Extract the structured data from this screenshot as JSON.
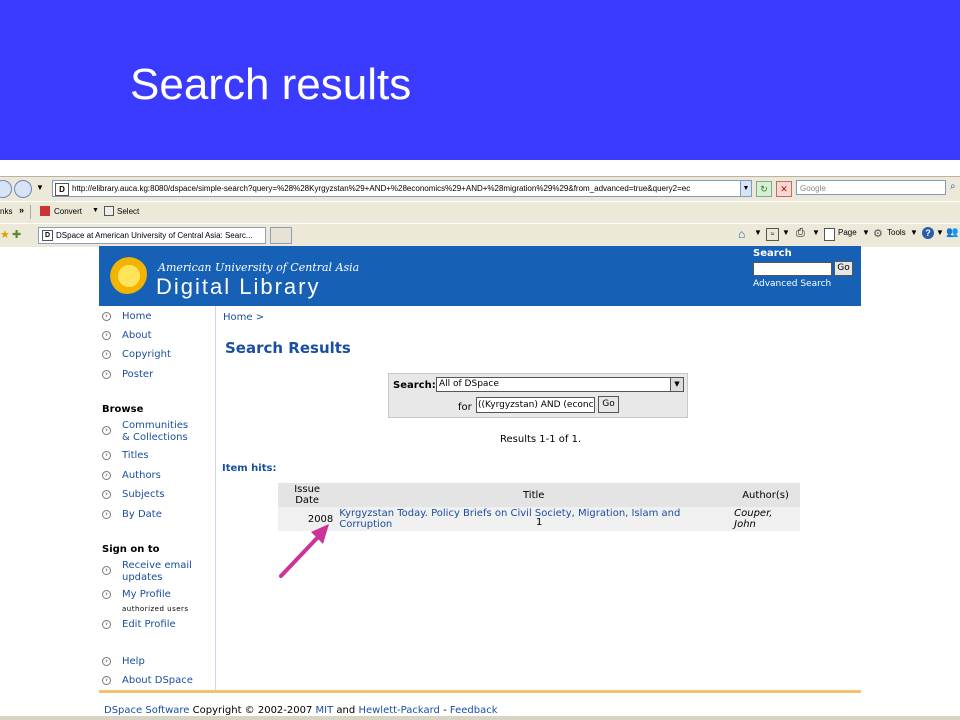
{
  "slide": {
    "title": "Search results"
  },
  "browser": {
    "url": "http://elibrary.auca.kg:8080/dspace/simple-search?query=%28%28Kyrgyzstan%29+AND+%28economics%29+AND+%28migration%29%29&from_advanced=true&query2=ec",
    "search_placeholder": "Google",
    "links_label": "nks",
    "links_more": "»",
    "convert_label": "Convert",
    "select_label": "Select",
    "tab_title": "DSpace at American University of Central Asia: Searc...",
    "page_menu": "Page",
    "tools_menu": "Tools",
    "icons": [
      "back-icon",
      "forward-icon",
      "refresh-icon",
      "stop-icon",
      "search-icon",
      "favorites-star-icon",
      "add-favorite-icon",
      "home-icon",
      "feeds-icon",
      "print-icon",
      "page-icon",
      "tools-icon",
      "help-icon"
    ]
  },
  "header": {
    "subtitle": "American University of Central Asia",
    "title": "Digital Library",
    "search_label": "Search",
    "go_label": "Go",
    "advanced_search": "Advanced Search"
  },
  "sidebar": {
    "top_items": [
      "Home",
      "About",
      "Copyright",
      "Poster"
    ],
    "browse_heading": "Browse",
    "browse_items": [
      "Communities",
      "& Collections",
      "Titles",
      "Authors",
      "Subjects",
      "By Date"
    ],
    "signon_heading": "Sign on to",
    "signon_items": [
      "Receive email",
      "updates",
      "My Profile",
      "authorized users",
      "Edit Profile"
    ],
    "bottom_items": [
      "Help",
      "About DSpace"
    ]
  },
  "main": {
    "breadcrumb": "Home >",
    "heading": "Search Results",
    "search_label": "Search:",
    "scope_value": "All of DSpace",
    "for_label": "for",
    "query_value": "((Kyrgyzstan) AND (econc",
    "go_label": "Go",
    "results_count": "Results 1-1 of 1.",
    "item_hits": "Item hits:",
    "table": {
      "headers": [
        "Issue Date",
        "Title",
        "Author(s)"
      ],
      "rows": [
        [
          "2008",
          "Kyrgyzstan Today. Policy Briefs on Civil Society, Migration, Islam and Corruption",
          "Couper, John"
        ]
      ]
    },
    "pager": "1"
  },
  "footer": {
    "software": "DSpace Software",
    "copyright": "Copyright © 2002-2007",
    "mit": "MIT",
    "and": "and",
    "hp": "Hewlett-Packard",
    "dash": "-",
    "feedback": "Feedback"
  },
  "colors": {
    "slide_bg": "#3b3bff",
    "header_blue": "#1660b6",
    "link_blue": "#1a4fa0",
    "arrow": "#cc3399"
  }
}
